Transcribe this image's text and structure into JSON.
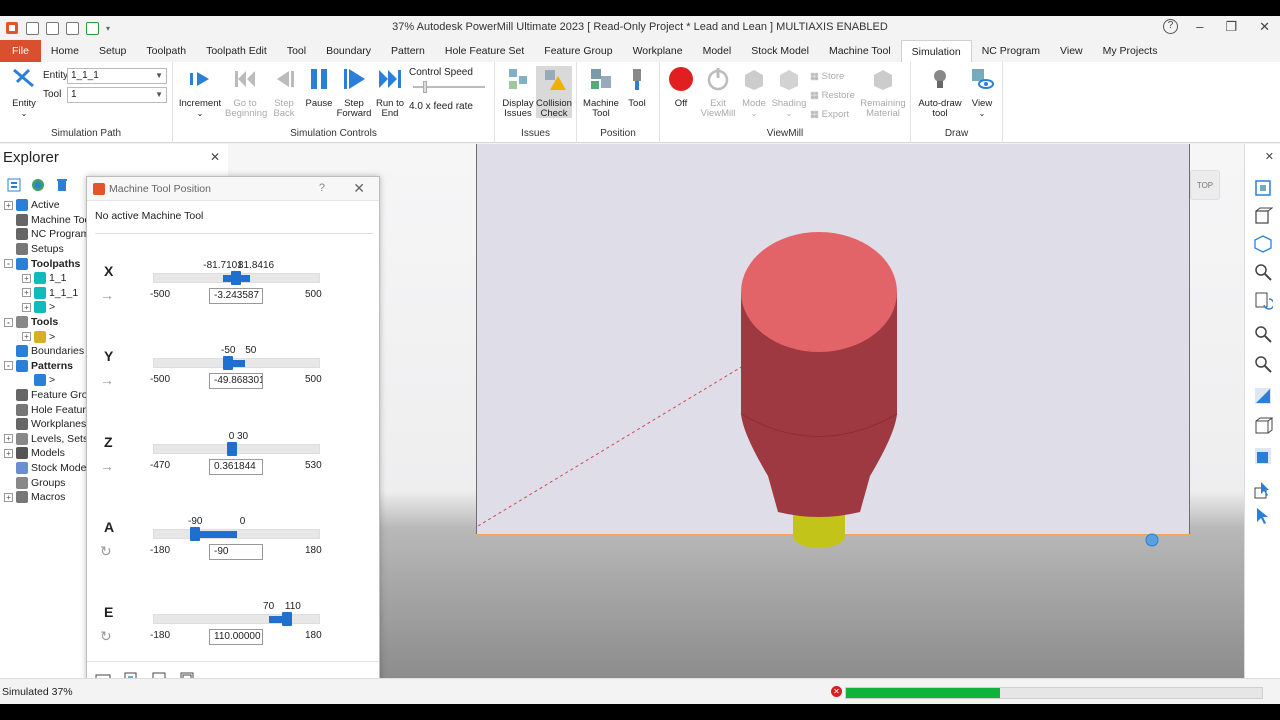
{
  "window": {
    "title": "37% Autodesk PowerMill Ultimate 2023    [ Read-Only Project * Lead and Lean ]    MULTIAXIS ENABLED"
  },
  "tabs": [
    "File",
    "Home",
    "Setup",
    "Toolpath",
    "Toolpath Edit",
    "Tool",
    "Boundary",
    "Pattern",
    "Hole Feature Set",
    "Feature Group",
    "Workplane",
    "Model",
    "Stock Model",
    "Machine Tool",
    "Simulation",
    "NC Program",
    "View",
    "My Projects"
  ],
  "active_tab": "Simulation",
  "ribbon": {
    "sim_path": {
      "entity_label": "Entity",
      "entity_combo_label": "Entity",
      "entity_value": "1_1_1",
      "tool_label": "Tool",
      "tool_value": "1",
      "group_title": "Simulation Path"
    },
    "controls": {
      "increment": "Increment",
      "go_begin": "Go to Beginning",
      "step_back": "Step Back",
      "pause": "Pause",
      "step_forward": "Step Forward",
      "run_to_end": "Run to End",
      "control_speed": "Control Speed",
      "feed_rate": "4.0 x feed rate",
      "group_title": "Simulation Controls"
    },
    "issues": {
      "display_issues": "Display Issues",
      "collision_check": "Collision Check",
      "group_title": "Issues"
    },
    "position": {
      "machine_tool": "Machine Tool",
      "tool": "Tool",
      "group_title": "Position"
    },
    "viewmill": {
      "off": "Off",
      "exit": "Exit ViewMill",
      "mode": "Mode",
      "shading": "Shading",
      "store": "Store",
      "restore": "Restore",
      "export": "Export",
      "remaining": "Remaining Material",
      "group_title": "ViewMill"
    },
    "draw": {
      "auto_draw": "Auto-draw tool",
      "view": "View",
      "group_title": "Draw"
    }
  },
  "explorer": {
    "title": "Explorer",
    "tree": [
      {
        "label": "Active",
        "bold": false,
        "exp": "+"
      },
      {
        "label": "Machine Tools",
        "bold": false,
        "exp": ""
      },
      {
        "label": "NC Programs",
        "bold": false,
        "exp": ""
      },
      {
        "label": "Setups",
        "bold": false,
        "exp": ""
      },
      {
        "label": "Toolpaths",
        "bold": true,
        "exp": "-"
      },
      {
        "label": "1_1",
        "bold": false,
        "exp": "+"
      },
      {
        "label": "1_1_1",
        "bold": false,
        "exp": "+"
      },
      {
        "label": ">",
        "bold": false,
        "exp": "+"
      },
      {
        "label": "Tools",
        "bold": true,
        "exp": "-"
      },
      {
        "label": ">",
        "bold": false,
        "exp": "+"
      },
      {
        "label": "Boundaries",
        "bold": false,
        "exp": ""
      },
      {
        "label": "Patterns",
        "bold": true,
        "exp": "-"
      },
      {
        "label": ">",
        "bold": false,
        "exp": ""
      },
      {
        "label": "Feature Groups",
        "bold": false,
        "exp": ""
      },
      {
        "label": "Hole Feature Sets",
        "bold": false,
        "exp": ""
      },
      {
        "label": "Workplanes",
        "bold": false,
        "exp": ""
      },
      {
        "label": "Levels, Sets",
        "bold": false,
        "exp": "+"
      },
      {
        "label": "Models",
        "bold": false,
        "exp": "+"
      },
      {
        "label": "Stock Models",
        "bold": false,
        "exp": ""
      },
      {
        "label": "Groups",
        "bold": false,
        "exp": ""
      },
      {
        "label": "Macros",
        "bold": false,
        "exp": "+"
      }
    ]
  },
  "dialog": {
    "title": "Machine Tool Position",
    "help": "?",
    "status": "No active Machine Tool",
    "axes": [
      {
        "name": "X",
        "type": "linear",
        "min": -500,
        "max": 500,
        "lo": -81.7101,
        "hi": 81.8416,
        "lo_label": "-81.7101",
        "hi_label": "81.8416",
        "min_label": "-500",
        "max_label": "500",
        "value": -3.243587,
        "value_text": "-3.243587"
      },
      {
        "name": "Y",
        "type": "linear",
        "min": -500,
        "max": 500,
        "lo": -50,
        "hi": 50,
        "lo_label": "-50",
        "hi_label": "50",
        "min_label": "-500",
        "max_label": "500",
        "value": -49.868301,
        "value_text": "-49.868301"
      },
      {
        "name": "Z",
        "type": "linear",
        "min": -470,
        "max": 530,
        "lo": 0,
        "hi": 30,
        "lo_label": "0",
        "hi_label": "30",
        "min_label": "-470",
        "max_label": "530",
        "value": 0.361844,
        "value_text": "0.361844"
      },
      {
        "name": "A",
        "type": "rotary",
        "min": -180,
        "max": 180,
        "lo": -90,
        "hi": 0,
        "lo_label": "-90",
        "hi_label": "0",
        "min_label": "-180",
        "max_label": "180",
        "value": -90,
        "value_text": "-90"
      },
      {
        "name": "E",
        "type": "rotary",
        "min": -180,
        "max": 180,
        "lo": 70,
        "hi": 110,
        "lo_label": "70",
        "hi_label": "110",
        "min_label": "-180",
        "max_label": "180",
        "value": 110,
        "value_text": "110.00000"
      }
    ]
  },
  "viewport": {
    "view_button": "TOP"
  },
  "status": {
    "text": "Simulated 37%",
    "progress": 0.37
  },
  "colors": {
    "accent": "#1f6fd1",
    "file_tab": "#d9502e",
    "tool_tip": "#e06468",
    "tool_body": "#a03a42",
    "holder": "#c8c820",
    "progress": "#0fb23b"
  }
}
